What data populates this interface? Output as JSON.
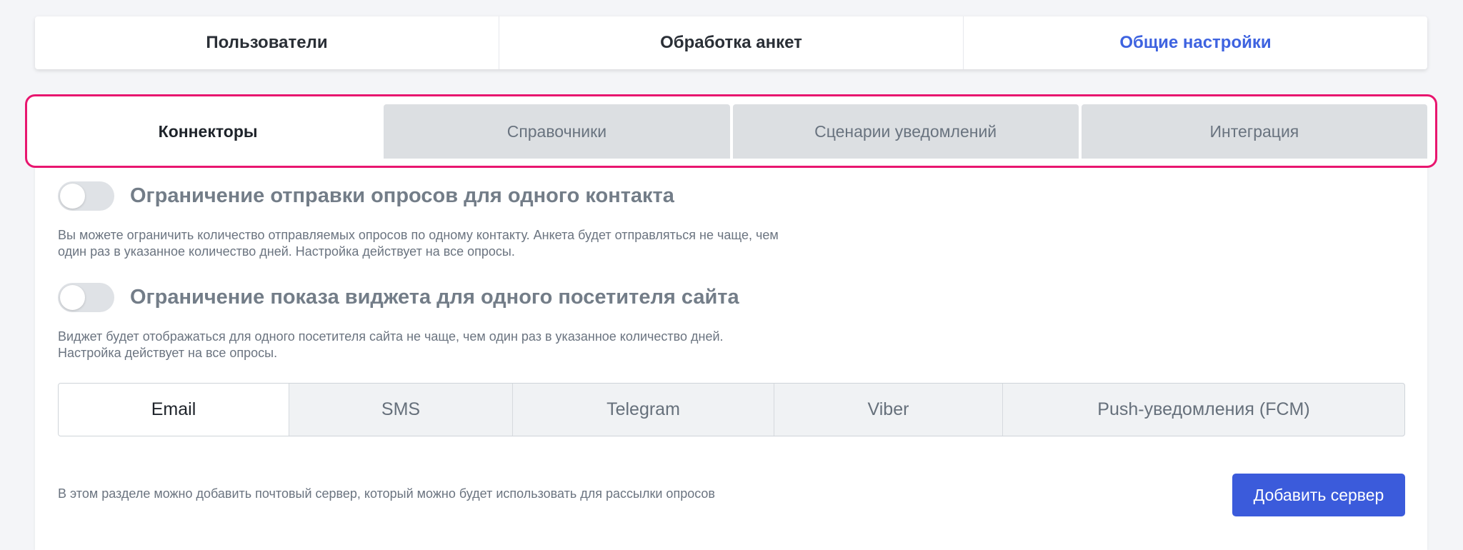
{
  "top_tabs": [
    {
      "label": "Пользователи",
      "active": false
    },
    {
      "label": "Обработка анкет",
      "active": false
    },
    {
      "label": "Общие настройки",
      "active": true
    }
  ],
  "sub_tabs": [
    {
      "label": "Коннекторы",
      "active": true
    },
    {
      "label": "Справочники",
      "active": false
    },
    {
      "label": "Сценарии уведомлений",
      "active": false
    },
    {
      "label": "Интеграция",
      "active": false
    }
  ],
  "settings": {
    "survey_limit": {
      "title": "Ограничение отправки опросов для одного контакта",
      "enabled": false,
      "description": "Вы можете ограничить количество отправляемых опросов по одному контакту. Анкета будет отправляться не чаще, чем один раз в указанное количество дней. Настройка действует на все опросы."
    },
    "widget_limit": {
      "title": "Ограничение показа виджета для одного посетителя сайта",
      "enabled": false,
      "description": "Виджет будет отображаться для одного посетителя сайта не чаще, чем один раз в указанное количество дней. Настройка действует на все опросы."
    }
  },
  "channels": [
    {
      "label": "Email",
      "active": true
    },
    {
      "label": "SMS",
      "active": false
    },
    {
      "label": "Telegram",
      "active": false
    },
    {
      "label": "Viber",
      "active": false
    },
    {
      "label": "Push-уведомления (FCM)",
      "active": false
    }
  ],
  "email_section": {
    "info": "В этом разделе можно добавить почтовый сервер, который можно будет использовать для рассылки опросов",
    "add_button_label": "Добавить сервер"
  },
  "colors": {
    "accent": "#3b5bdb",
    "active_top_tab": "#3e63e0",
    "highlight_frame": "#e8166f"
  }
}
